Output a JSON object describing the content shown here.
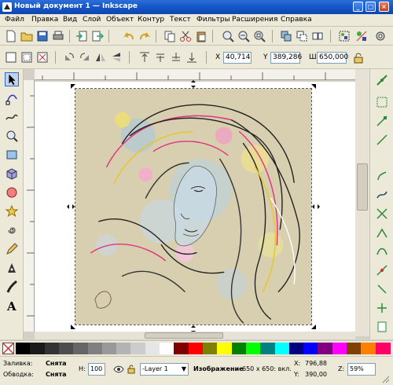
{
  "window": {
    "title": "Новый документ 1 — Inkscape",
    "buttons": [
      "_",
      "□",
      "×"
    ]
  },
  "menu": [
    "Файл",
    "Правка",
    "Вид",
    "Слой",
    "Объект",
    "Контур",
    "Текст",
    "Фильтры",
    "Расширения",
    "Справка"
  ],
  "toolbar1": {
    "icons": [
      "new-icon",
      "open-icon",
      "save-icon",
      "print-icon",
      "import-icon",
      "export-icon",
      "undo-icon",
      "redo-icon",
      "copy-icon",
      "cut-icon",
      "paste-icon",
      "zoom-selection-icon",
      "zoom-drawing-icon",
      "zoom-page-icon",
      "duplicate-icon",
      "clone-icon",
      "unlink-clone-icon",
      "group-icon",
      "ungroup-icon",
      "fill-stroke-icon",
      "text-font-icon",
      "transform-icon",
      "align-icon",
      "xml-editor-icon",
      "preferences-icon"
    ]
  },
  "toolbar2": {
    "x_label": "X",
    "x_value": "40,714",
    "y_label": "Y",
    "y_value": "389,286",
    "w_label": "Ш",
    "w_value": "650,000"
  },
  "left_tools": [
    "selector-icon",
    "node-icon",
    "tweak-icon",
    "zoom-icon",
    "rectangle-icon",
    "3d-box-icon",
    "ellipse-icon",
    "star-icon",
    "spiral-icon",
    "pencil-icon",
    "pen-icon",
    "calligraphy-icon",
    "text-icon"
  ],
  "right_tools": [
    "snap-enable-icon",
    "snap-bbox-icon",
    "snap-bbox-edge-icon",
    "snap-bbox-corner-icon",
    "snap-nodes-icon",
    "snap-path-icon",
    "snap-intersection-icon",
    "snap-cusp-icon",
    "snap-smooth-icon",
    "snap-midpoint-icon",
    "snap-center-icon",
    "snap-rotation-icon",
    "snap-page-icon"
  ],
  "palette": {
    "colors": [
      "#000000",
      "#1a1a1a",
      "#333333",
      "#4d4d4d",
      "#666666",
      "#808080",
      "#999999",
      "#b3b3b3",
      "#cccccc",
      "#e6e6e6",
      "#ffffff",
      "#800000",
      "#ff0000",
      "#808000",
      "#ffff00",
      "#008000",
      "#00ff00",
      "#008080",
      "#00ffff",
      "#000080",
      "#0000ff",
      "#800080",
      "#ff00ff",
      "#804000",
      "#ff8000",
      "#ff0066"
    ]
  },
  "status": {
    "fill_label": "Заливка:",
    "fill_value": "Снята",
    "stroke_label": "Обводка:",
    "stroke_value": "Снята",
    "h_label": "Н:",
    "h_value": "100",
    "layer": "-Layer 1",
    "image_info_bold": "Изображение",
    "image_info": "650 x 650: вкл.",
    "x_label": "X:",
    "x_value": "796,88",
    "y_label": "Y:",
    "y_value": "390,00",
    "zoom_label": "Z:",
    "zoom_value": "59%"
  }
}
